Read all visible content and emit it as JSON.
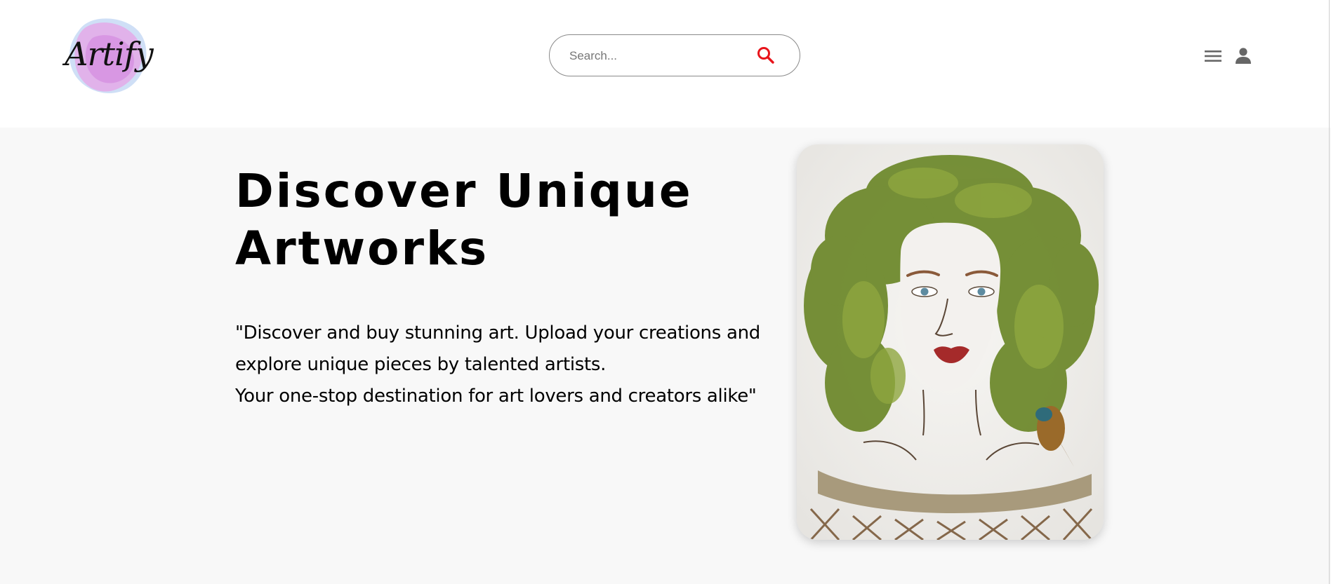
{
  "header": {
    "logo": {
      "text": "Artify",
      "icon": "artify-logo"
    },
    "search": {
      "placeholder": "Search...",
      "value": "",
      "icon": "search-icon"
    },
    "actions": [
      {
        "icon": "menu-icon"
      },
      {
        "icon": "user-icon"
      }
    ]
  },
  "hero": {
    "title_line1": "Discover Unique",
    "title_line2": "Artworks",
    "description_line1": "\"Discover and buy stunning art. Upload your creations and",
    "description_line2": "explore unique pieces by talented artists.",
    "description_line3": "Your one-stop destination for art lovers and creators alike\"",
    "image": "leaf-portrait-artwork"
  },
  "colors": {
    "accent": "#e8141b",
    "page_background": "#f8f8f8",
    "header_background": "#ffffff",
    "icon_gray": "#666666"
  }
}
